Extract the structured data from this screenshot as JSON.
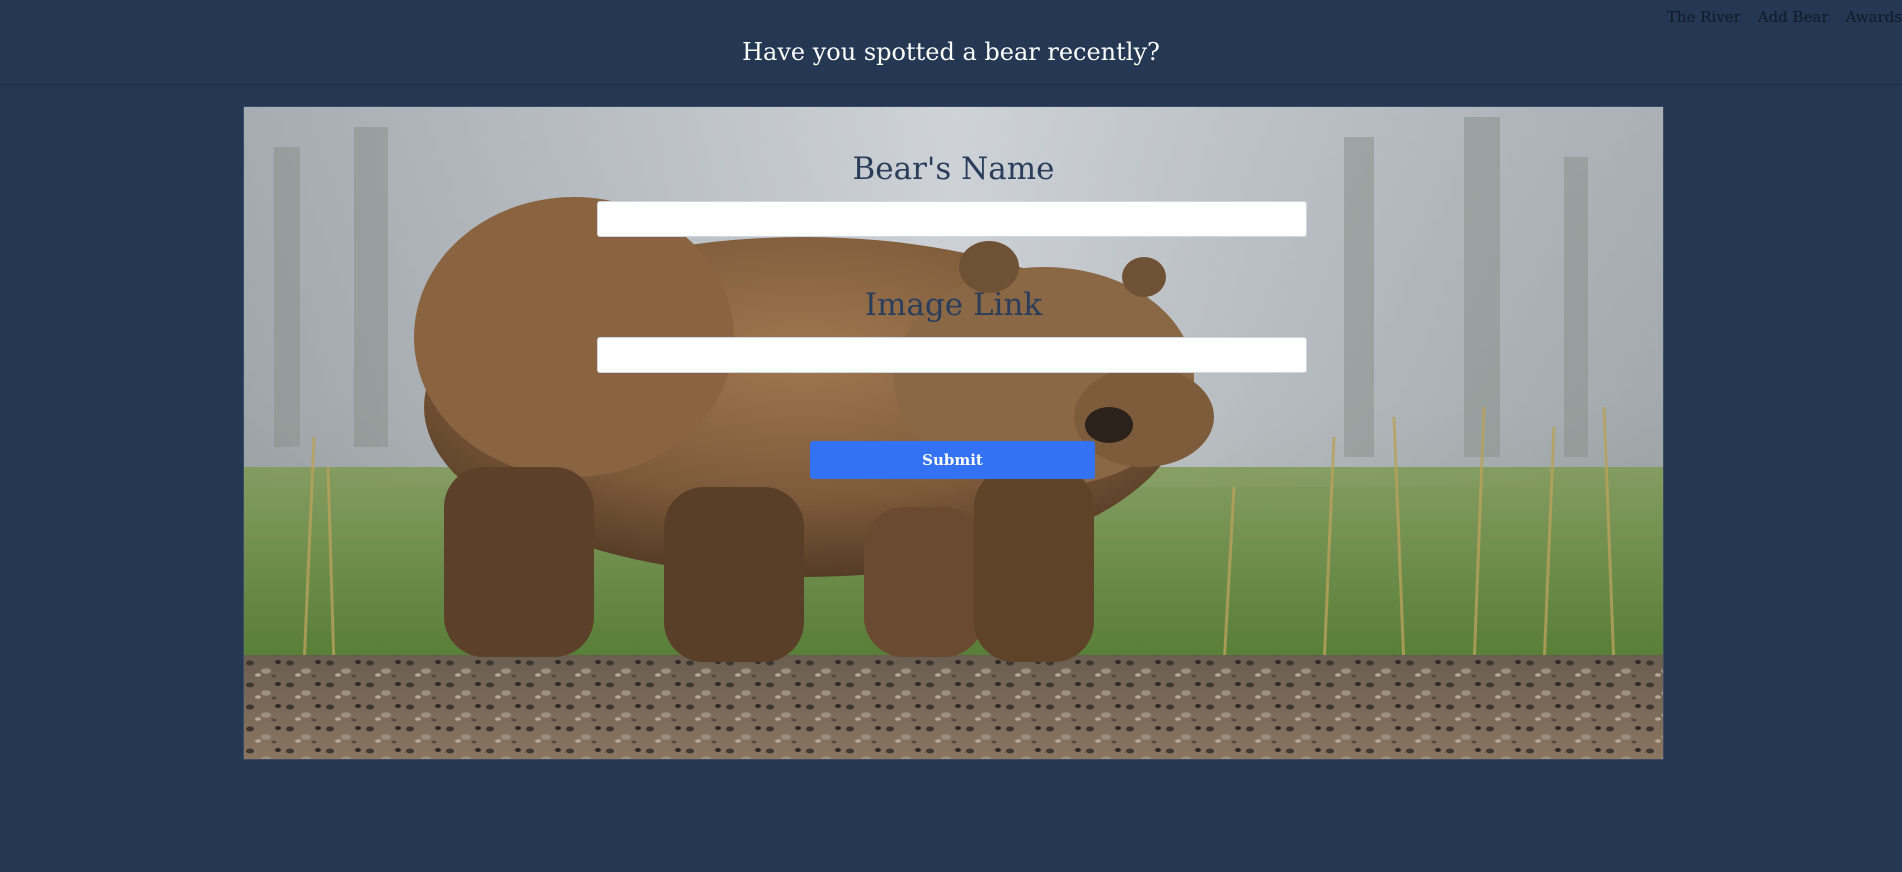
{
  "nav": {
    "items": [
      "The River",
      "Add Bear",
      "Awards"
    ]
  },
  "header": {
    "title": "Have you spotted a bear recently?"
  },
  "form": {
    "name_label": "Bear's Name",
    "name_value": "",
    "image_label": "Image Link",
    "image_value": "",
    "submit_label": "Submit"
  },
  "colors": {
    "background": "#253853",
    "header_text": "#ffffff",
    "nav_text": "#0f1a28",
    "label_text": "#2a3e5c",
    "button": "#3272f3"
  },
  "hero": {
    "image_subject": "brown bear walking on gravel beach"
  }
}
